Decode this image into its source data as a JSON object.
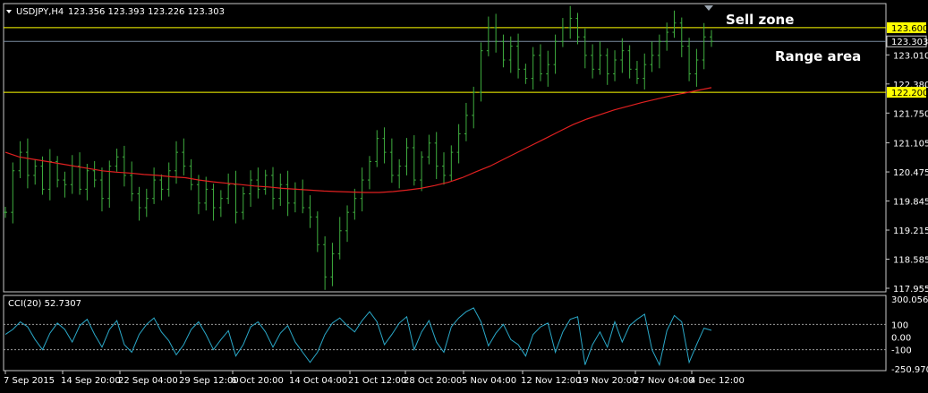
{
  "header": {
    "symbol_label": "USDJPY,H4",
    "ohlc": "123.356 123.393 123.226 123.303",
    "dropdown_icon": "triangle-down-icon"
  },
  "annotations": {
    "sell_zone": "Sell zone",
    "range_area": "Range area"
  },
  "colors": {
    "background": "#000000",
    "candles": "#3fae3f",
    "moving_average": "#e02020",
    "level_line": "#ffff00",
    "price_line": "#7a8ca0",
    "cci_line": "#2aa8c8",
    "frame": "#c8c8c8",
    "label_bg": "#ffff00"
  },
  "chart_data": [
    {
      "type": "line",
      "title": "USDJPY,H4",
      "price_ticks": [
        "123.010",
        "122.380",
        "121.750",
        "121.105",
        "120.475",
        "119.845",
        "119.215",
        "118.585",
        "117.955"
      ],
      "ylim": [
        117.955,
        123.85
      ],
      "x_tick_labels": [
        "7 Sep 2015",
        "14 Sep 20:00",
        "22 Sep 04:00",
        "29 Sep 12:00",
        "6 Oct 20:00",
        "14 Oct 04:00",
        "21 Oct 12:00",
        "28 Oct 20:00",
        "5 Nov 04:00",
        "12 Nov 12:00",
        "19 Nov 20:00",
        "27 Nov 04:00",
        "4 Dec 12:00"
      ],
      "series": [
        {
          "name": "",
          "kind": "close",
          "values": [
            119.6,
            120.5,
            120.9,
            120.4,
            120.6,
            120.1,
            120.7,
            120.3,
            120.2,
            120.6,
            120.1,
            120.5,
            120.3,
            119.9,
            120.6,
            120.8,
            120.4,
            120.0,
            119.7,
            119.9,
            120.3,
            120.1,
            120.5,
            120.9,
            120.6,
            120.2,
            119.8,
            120.1,
            119.7,
            119.9,
            120.2,
            119.6,
            120.0,
            120.3,
            120.1,
            120.4,
            119.9,
            120.2,
            119.8,
            120.1,
            119.7,
            119.5,
            118.9,
            118.2,
            118.7,
            119.2,
            119.6,
            119.9,
            120.3,
            120.7,
            121.2,
            120.9,
            120.4,
            120.6,
            121.0,
            120.3,
            120.8,
            121.1,
            120.6,
            120.4,
            120.9,
            121.3,
            121.7,
            122.2,
            123.1,
            123.6,
            123.3,
            122.9,
            123.2,
            122.7,
            122.5,
            123.0,
            122.6,
            122.8,
            123.3,
            123.6,
            123.8,
            123.4,
            123.0,
            122.7,
            123.0,
            122.6,
            122.9,
            123.1,
            122.7,
            122.5,
            122.8,
            123.0,
            123.3,
            123.5,
            123.7,
            123.2,
            122.6,
            122.9,
            123.4,
            123.303
          ]
        },
        {
          "name": "",
          "kind": "moving_average",
          "values": [
            120.9,
            120.8,
            120.75,
            120.7,
            120.65,
            120.6,
            120.55,
            120.5,
            120.47,
            120.45,
            120.42,
            120.4,
            120.37,
            120.35,
            120.3,
            120.26,
            120.23,
            120.2,
            120.17,
            120.15,
            120.12,
            120.1,
            120.08,
            120.06,
            120.05,
            120.04,
            120.03,
            120.03,
            120.05,
            120.08,
            120.12,
            120.18,
            120.25,
            120.35,
            120.48,
            120.6,
            120.75,
            120.9,
            121.05,
            121.2,
            121.35,
            121.5,
            121.62,
            121.72,
            121.82,
            121.9,
            121.98,
            122.05,
            122.12,
            122.18,
            122.24,
            122.3
          ]
        }
      ],
      "levels": [
        {
          "label": "123.600",
          "value": 123.6,
          "style": "yellow"
        },
        {
          "label": "123.303",
          "value": 123.303,
          "style": "current"
        },
        {
          "label": "122.200",
          "value": 122.2,
          "style": "yellow"
        }
      ]
    },
    {
      "type": "line",
      "title": "CCI(20) 52.7307",
      "y_tick_labels": [
        "300.0569",
        "100",
        "0.00",
        "-100",
        "-250.9701"
      ],
      "ylim": [
        -250.9701,
        300.0569
      ],
      "levels": [
        100,
        -100
      ],
      "series": [
        {
          "name": "",
          "values": [
            20,
            60,
            120,
            80,
            -20,
            -100,
            30,
            110,
            60,
            -40,
            90,
            140,
            20,
            -80,
            60,
            130,
            -60,
            -120,
            20,
            100,
            150,
            40,
            -30,
            -140,
            -60,
            60,
            120,
            20,
            -100,
            -20,
            50,
            -150,
            -60,
            80,
            120,
            40,
            -80,
            30,
            90,
            -40,
            -120,
            -200,
            -120,
            20,
            110,
            150,
            90,
            40,
            130,
            200,
            120,
            -60,
            20,
            110,
            160,
            -100,
            40,
            130,
            -40,
            -120,
            80,
            150,
            200,
            230,
            120,
            -70,
            30,
            100,
            -20,
            -60,
            -150,
            20,
            80,
            110,
            -120,
            40,
            140,
            160,
            -220,
            -60,
            40,
            -80,
            120,
            -40,
            90,
            140,
            180,
            -100,
            -220,
            50,
            170,
            120,
            -200,
            -60,
            70,
            52.7
          ]
        }
      ]
    }
  ]
}
